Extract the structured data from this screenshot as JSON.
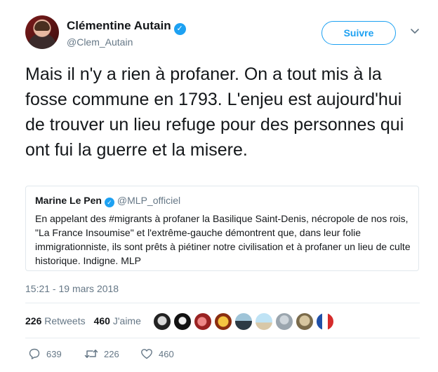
{
  "author": {
    "name": "Clémentine Autain",
    "handle": "@Clem_Autain",
    "verified_icon": "verified-badge-icon",
    "follow_label": "Suivre"
  },
  "tweet": {
    "text": "Mais il n'y a rien à profaner. On a tout mis à la fosse commune en 1793. L'enjeu est aujourd'hui de trouver un lieu refuge pour des personnes qui ont fui la guerre et la misere.",
    "timestamp": "15:21 - 19 mars 2018"
  },
  "quoted": {
    "name": "Marine Le Pen",
    "verified_icon": "verified-badge-icon",
    "handle": "@MLP_officiel",
    "text_before": "En appelant des ",
    "hashtag": "#migrants",
    "text_after": " à profaner la Basilique Saint-Denis, nécropole de nos rois, \"La France Insoumise\" et l'extrême-gauche démontrent que, dans leur folie immigrationniste, ils sont prêts à piétiner notre civilisation et à profaner un lieu de culte historique. Indigne. MLP"
  },
  "stats": {
    "retweets_count": "226",
    "retweets_label": "Retweets",
    "likes_count": "460",
    "likes_label": "J'aime"
  },
  "actions": {
    "reply_count": "639",
    "retweet_count": "226",
    "like_count": "460"
  },
  "colors": {
    "accent": "#1da1f2",
    "secondary_text": "#657786",
    "border": "#e1e8ed"
  }
}
